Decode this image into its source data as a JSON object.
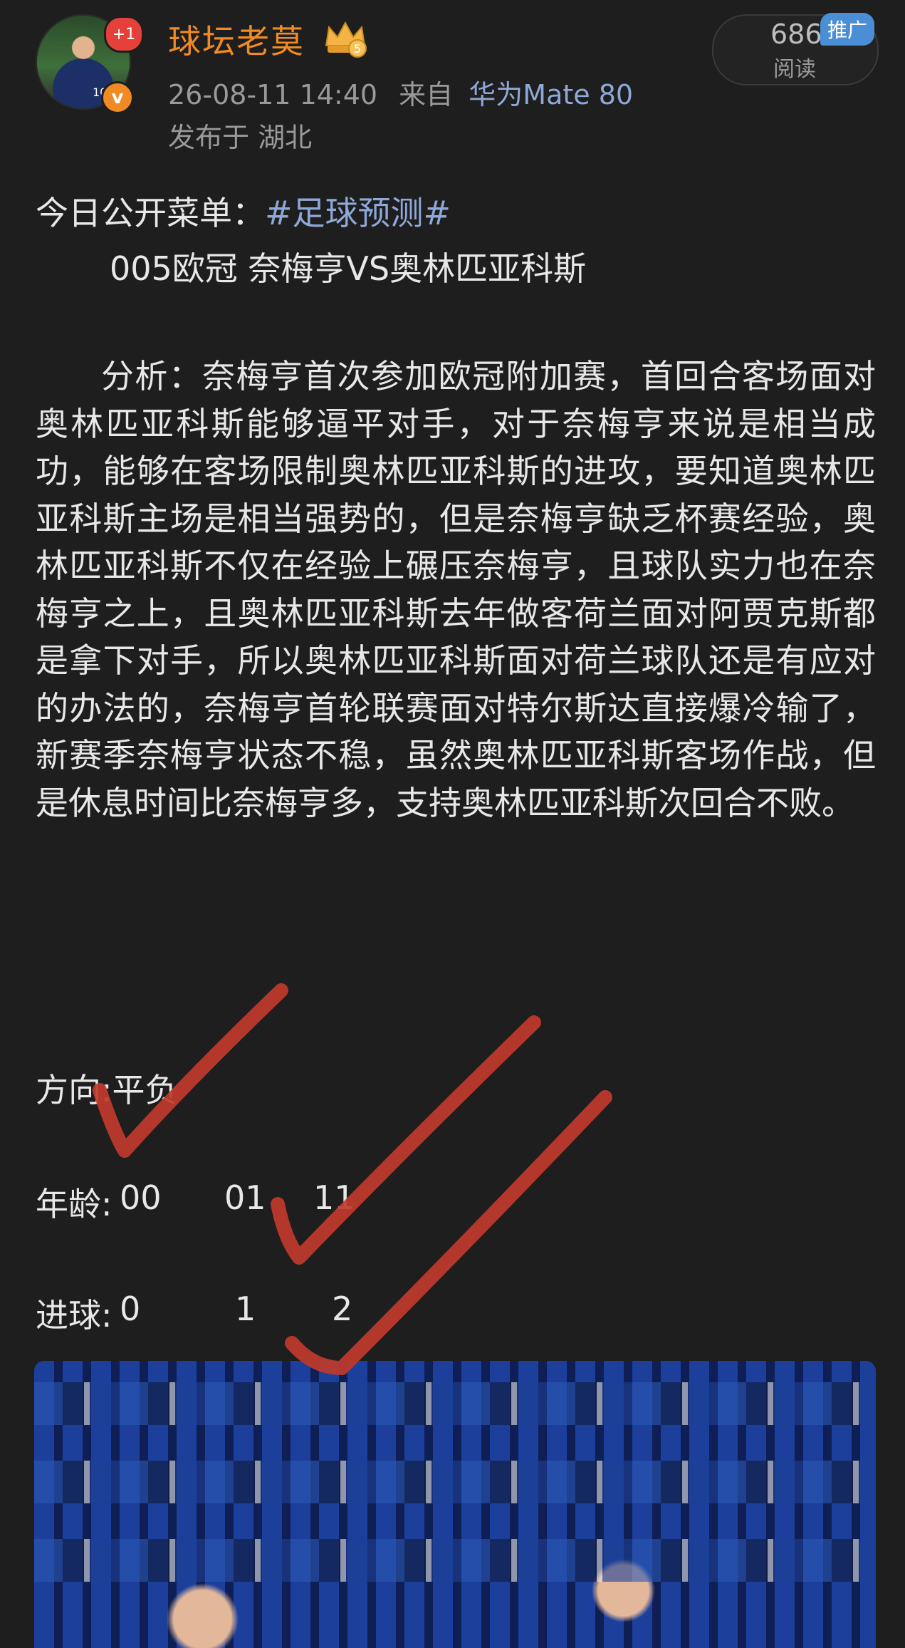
{
  "header": {
    "username": "球坛老莫",
    "level_badge": "5",
    "notification_badge": "+1",
    "verified_mark": "v",
    "timestamp": "26-08-11 14:40",
    "source_prefix": "来自",
    "device": "华为Mate 80",
    "location": "发布于 湖北",
    "read_count": "686",
    "read_label": "阅读",
    "promo_label": "推广",
    "avatar_jersey_number": "10"
  },
  "post": {
    "intro_label": "今日公开菜单：",
    "topic_tag": "#足球预测#",
    "match_line": "005欧冠 奈梅亨VS奥林匹亚科斯",
    "analysis": "分析：奈梅亨首次参加欧冠附加赛，首回合客场面对奥林匹亚科斯能够逼平对手，对于奈梅亨来说是相当成功，能够在客场限制奥林匹亚科斯的进攻，要知道奥林匹亚科斯主场是相当强势的，但是奈梅亨缺乏杯赛经验，奥林匹亚科斯不仅在经验上碾压奈梅亨，且球队实力也在奈梅亨之上，且奥林匹亚科斯去年做客荷兰面对阿贾克斯都是拿下对手，所以奥林匹亚科斯面对荷兰球队还是有应对的办法的，奈梅亨首轮联赛面对特尔斯达直接爆冷输了，新赛季奈梅亨状态不稳，虽然奥林匹亚科斯客场作战，但是休息时间比奈梅亨多，支持奥林匹亚科斯次回合不败。",
    "direction_line": "方向:平负",
    "score_label": "年龄:",
    "score_values": [
      "00",
      "01",
      "11"
    ],
    "goals_label": "进球:",
    "goals_values": [
      "0",
      "1",
      "2"
    ]
  },
  "colors": {
    "background": "#1e1e1e",
    "username": "#f08a24",
    "link": "#8ea8d8",
    "check_marks": "#c0392b"
  }
}
